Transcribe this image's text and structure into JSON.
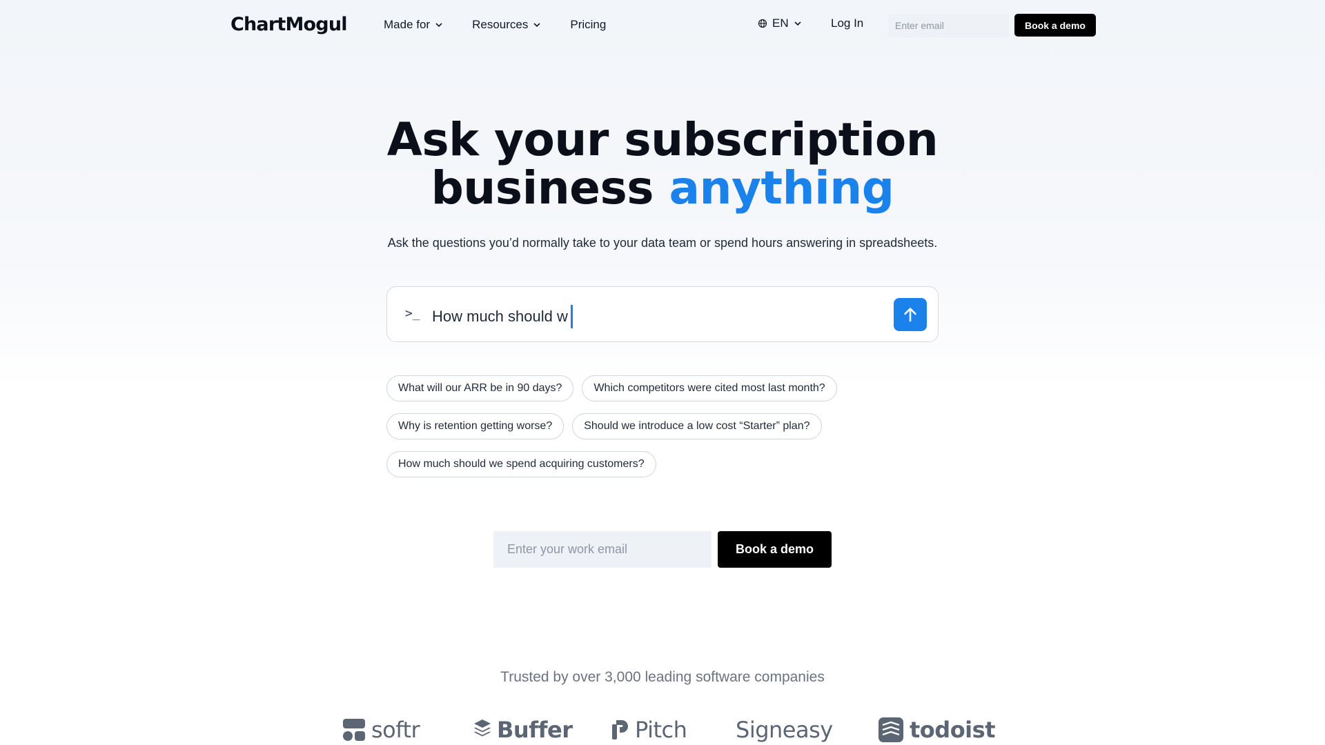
{
  "header": {
    "logo": "ChartMogul",
    "nav": [
      {
        "label": "Made for",
        "has_menu": true
      },
      {
        "label": "Resources",
        "has_menu": true
      },
      {
        "label": "Pricing",
        "has_menu": false
      }
    ],
    "language": "EN",
    "login_label": "Log In",
    "email_placeholder": "Enter email",
    "demo_label": "Book a demo"
  },
  "hero": {
    "title_line1": "Ask your subscription",
    "title_line2_plain": "business ",
    "title_line2_accent": "anything",
    "subtitle": "Ask the questions you’d normally take to your data team or spend hours answering in spreadsheets."
  },
  "prompt": {
    "prefix": ">_",
    "typed_text": "How much should w"
  },
  "suggestions": [
    [
      "What will our ARR be in 90 days?",
      "Which competitors were cited most last month?"
    ],
    [
      "Why is retention getting worse?",
      "Should we introduce a low cost “Starter” plan?"
    ],
    [
      "How much should we spend acquiring customers?"
    ]
  ],
  "cta": {
    "email_placeholder": "Enter your work email",
    "demo_label": "Book a demo"
  },
  "trusted": {
    "text": "Trusted by over 3,000 leading software companies",
    "logos": [
      "softr",
      "Buffer",
      "Pitch",
      "Signeasy",
      "todoist"
    ]
  },
  "colors": {
    "accent": "#1a82ea",
    "logo_gray": "#5b6573"
  }
}
